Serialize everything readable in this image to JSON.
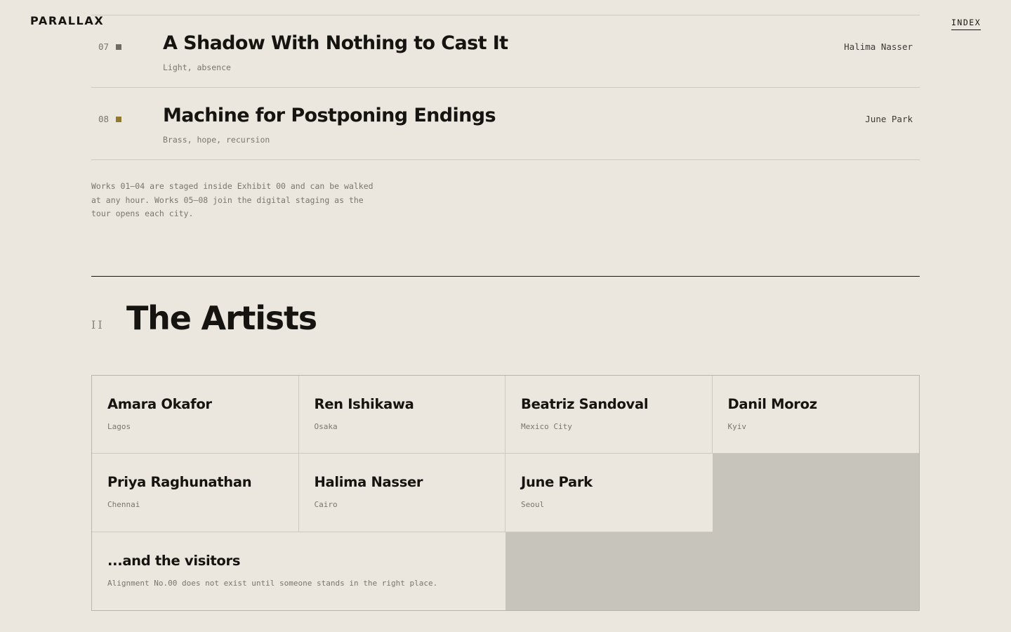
{
  "header": {
    "logo": "PARALLAX",
    "nav_index": "INDEX"
  },
  "works": [
    {
      "number": "07",
      "title": "A Shadow With Nothing to Cast It",
      "tags": "Light, absence",
      "artist": "Halima Nasser",
      "dot_color": "#6f6b62"
    },
    {
      "number": "08",
      "title": "Machine for Postponing Endings",
      "tags": "Brass, hope, recursion",
      "artist": "June Park",
      "dot_color": "#8f7a2e"
    }
  ],
  "works_note": "Works 01–04 are staged inside Exhibit 00 and can be walked at any hour. Works 05–08 join the digital staging as the tour opens each city.",
  "artists_section": {
    "number": "II",
    "title": "The Artists",
    "artists": [
      {
        "name": "Amara Okafor",
        "city": "Lagos"
      },
      {
        "name": "Ren Ishikawa",
        "city": "Osaka"
      },
      {
        "name": "Beatriz Sandoval",
        "city": "Mexico City"
      },
      {
        "name": "Danil Moroz",
        "city": "Kyiv"
      },
      {
        "name": "Priya Raghunathan",
        "city": "Chennai"
      },
      {
        "name": "Halima Nasser",
        "city": "Cairo"
      },
      {
        "name": "June Park",
        "city": "Seoul"
      }
    ],
    "visitors": {
      "title": "...and the visitors",
      "text": "Alignment No.00 does not exist until someone stands in the right place."
    }
  }
}
